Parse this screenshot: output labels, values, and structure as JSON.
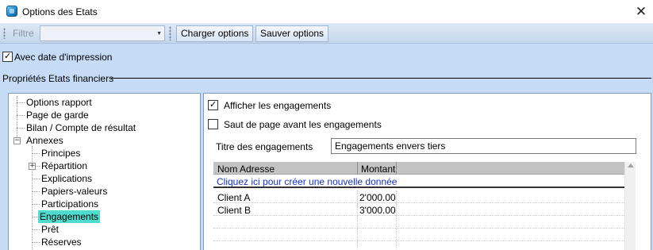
{
  "window": {
    "title": "Options des Etats",
    "close_glyph": "✕"
  },
  "toolbar": {
    "filter_label": "Filtre",
    "filter_value": "",
    "load_label": "Charger options",
    "save_label": "Sauver options"
  },
  "print_date": {
    "label": "Avec date d'impression",
    "checked": true
  },
  "group": {
    "label": "Propriétés Etats financiers"
  },
  "tree": {
    "items": [
      {
        "label": "Options rapport",
        "level": 0
      },
      {
        "label": "Page de garde",
        "level": 0
      },
      {
        "label": "Bilan / Compte de résultat",
        "level": 0
      },
      {
        "label": "Annexes",
        "level": 0,
        "expanded": true
      },
      {
        "label": "Principes",
        "level": 1
      },
      {
        "label": "Répartition",
        "level": 1,
        "collapsed": true
      },
      {
        "label": "Explications",
        "level": 1
      },
      {
        "label": "Papiers-valeurs",
        "level": 1
      },
      {
        "label": "Participations",
        "level": 1
      },
      {
        "label": "Engagements",
        "level": 1,
        "selected": true
      },
      {
        "label": "Prêt",
        "level": 1
      },
      {
        "label": "Réserves",
        "level": 1
      }
    ]
  },
  "panel": {
    "show_commitments": {
      "label": "Afficher les engagements",
      "checked": true
    },
    "page_break": {
      "label": "Saut de page avant les engagements",
      "checked": false
    },
    "title_label": "Titre des engagements",
    "title_value": "Engagements envers tiers",
    "grid": {
      "columns": [
        "Nom Adresse",
        "Montant"
      ],
      "new_row_text": "Cliquez ici pour créer une nouvelle donnée",
      "rows": [
        {
          "name": "Client A",
          "amount": "2'000.00"
        },
        {
          "name": "Client B",
          "amount": "3'000.00"
        }
      ]
    }
  },
  "colors": {
    "accent_selected": "#4fdbcd",
    "form_background": "#c6dbf5",
    "link_text": "#1432c8"
  }
}
